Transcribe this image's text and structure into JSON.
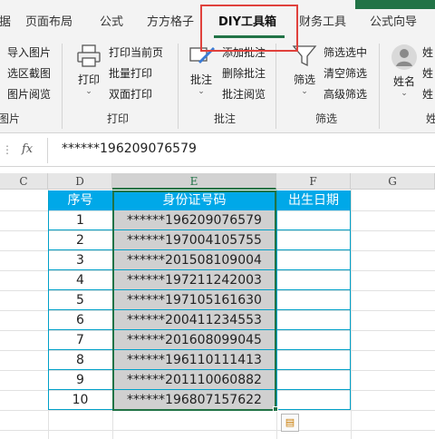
{
  "tabs": [
    {
      "label": "数据"
    },
    {
      "label": "页面布局"
    },
    {
      "label": "公式"
    },
    {
      "label": "方方格子"
    },
    {
      "label": "DIY工具箱"
    },
    {
      "label": "财务工具"
    },
    {
      "label": "公式向导"
    }
  ],
  "ribbon": {
    "group1": {
      "items": [
        "导入图片",
        "选区截图",
        "图片阅览"
      ],
      "label": "图片"
    },
    "print": {
      "big": "打印",
      "items": [
        "打印当前页",
        "批量打印",
        "双面打印"
      ],
      "label": "打印"
    },
    "comment": {
      "big": "批注",
      "items": [
        "添加批注",
        "删除批注",
        "批注阅览"
      ],
      "label": "批注"
    },
    "filter": {
      "big": "筛选",
      "items": [
        "筛选选中",
        "清空筛选",
        "高级筛选"
      ],
      "label": "筛选"
    },
    "name": {
      "big": "姓名",
      "items": [
        "姓",
        "姓",
        "姓"
      ],
      "label": "姓"
    }
  },
  "formula_bar": {
    "fx": "fx",
    "value": "******196209076579"
  },
  "columns": [
    "C",
    "D",
    "E",
    "F",
    "G"
  ],
  "table": {
    "headers": [
      "序号",
      "身份证号码",
      "出生日期"
    ],
    "rows": [
      {
        "n": "1",
        "id": "******196209076579"
      },
      {
        "n": "2",
        "id": "******197004105755"
      },
      {
        "n": "3",
        "id": "******201508109004"
      },
      {
        "n": "4",
        "id": "******197211242003"
      },
      {
        "n": "5",
        "id": "******197105161630"
      },
      {
        "n": "6",
        "id": "******200411234553"
      },
      {
        "n": "7",
        "id": "******201608099045"
      },
      {
        "n": "8",
        "id": "******196110111413"
      },
      {
        "n": "9",
        "id": "******201110060882"
      },
      {
        "n": "10",
        "id": "******196807157622"
      }
    ]
  },
  "colors": {
    "accent": "#217346",
    "header_fill": "#00a8e8",
    "highlight": "#e0413c",
    "selection_fill": "#d0d0d0"
  }
}
